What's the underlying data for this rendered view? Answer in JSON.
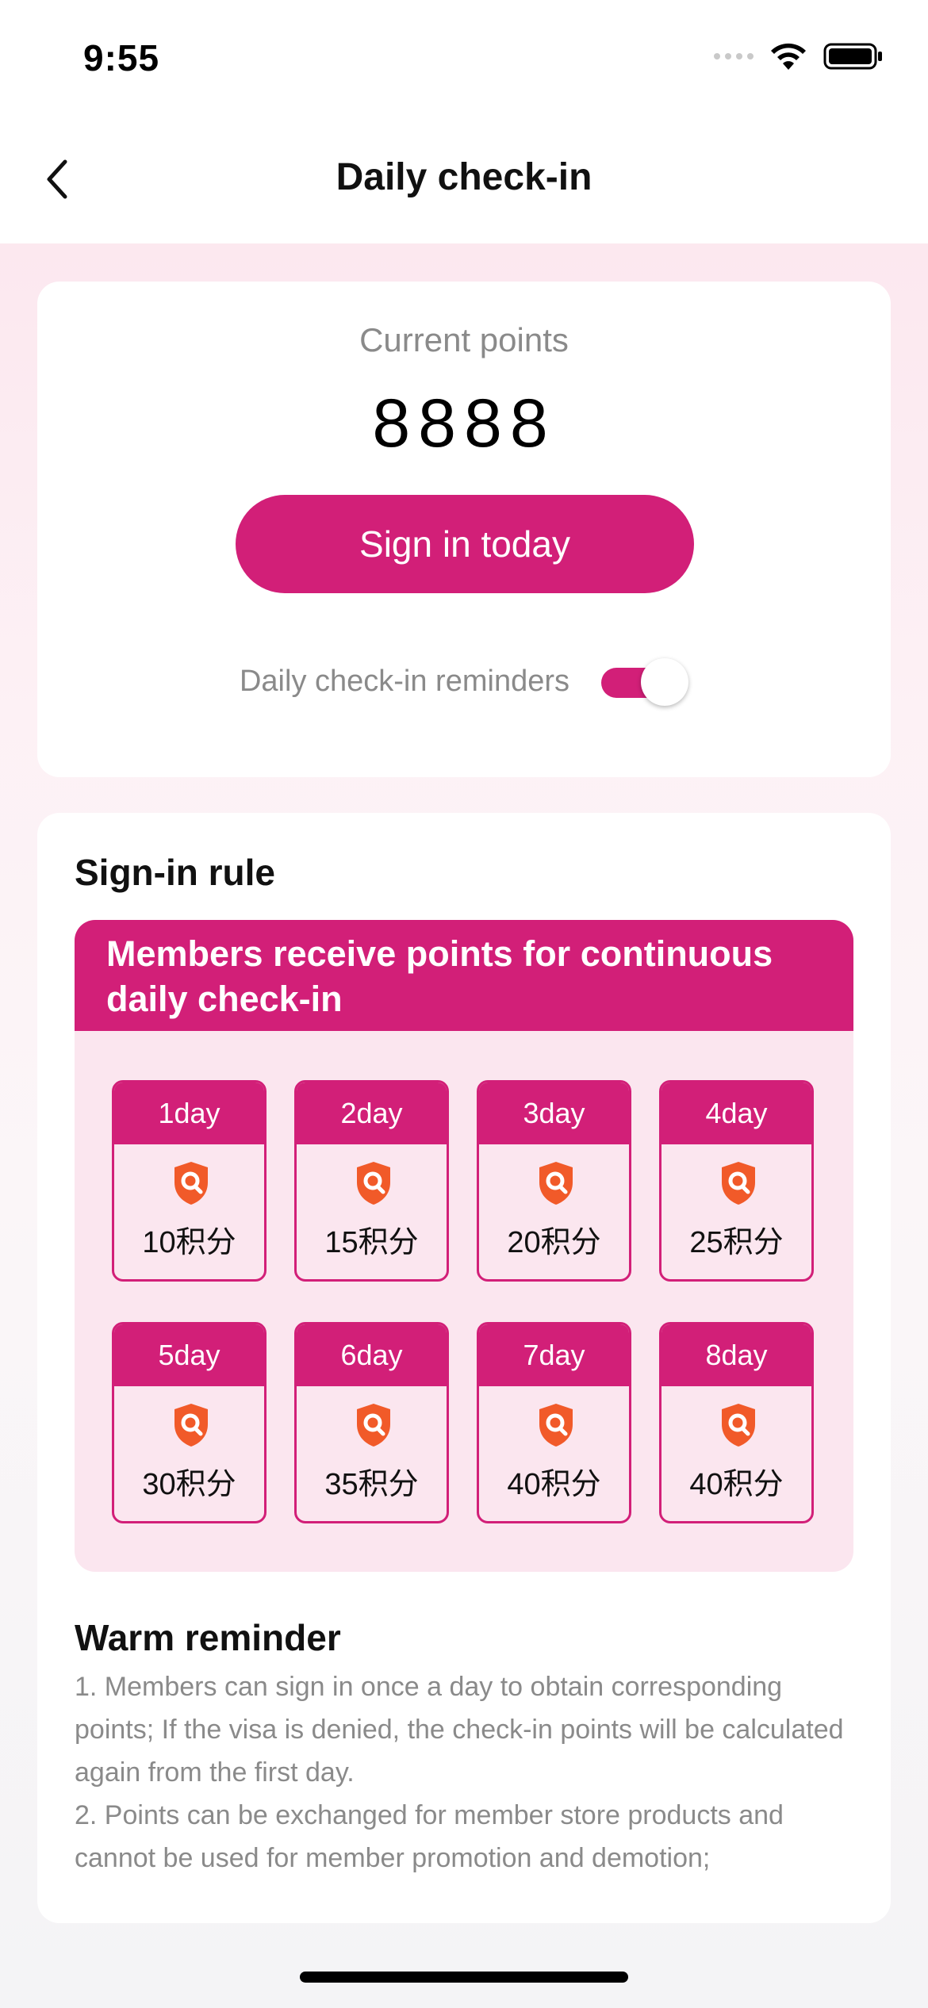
{
  "status_bar": {
    "time": "9:55"
  },
  "nav": {
    "title": "Daily check-in"
  },
  "points_card": {
    "label": "Current points",
    "value": "8888",
    "button": "Sign in today",
    "reminder_label": "Daily check-in reminders",
    "reminder_on": true
  },
  "rules": {
    "title": "Sign-in rule",
    "banner": "Members receive points for continuous daily check-in",
    "days": [
      {
        "day": "1day",
        "points": "10积分"
      },
      {
        "day": "2day",
        "points": "15积分"
      },
      {
        "day": "3day",
        "points": "20积分"
      },
      {
        "day": "4day",
        "points": "25积分"
      },
      {
        "day": "5day",
        "points": "30积分"
      },
      {
        "day": "6day",
        "points": "35积分"
      },
      {
        "day": "7day",
        "points": "40积分"
      },
      {
        "day": "8day",
        "points": "40积分"
      }
    ]
  },
  "warm": {
    "title": "Warm reminder",
    "line1": "1. Members can sign in once a day to obtain corresponding points; If the visa is denied, the check-in points will be calculated again from the first day.",
    "line2": "2. Points can be exchanged for member store products and cannot be used for member promotion and demotion;"
  },
  "colors": {
    "accent": "#d21f78",
    "tile_bg": "#fbe6ef",
    "icon": "#f15a29"
  },
  "icons": {
    "back": "chevron-left-icon",
    "tile": "shield-search-icon"
  }
}
